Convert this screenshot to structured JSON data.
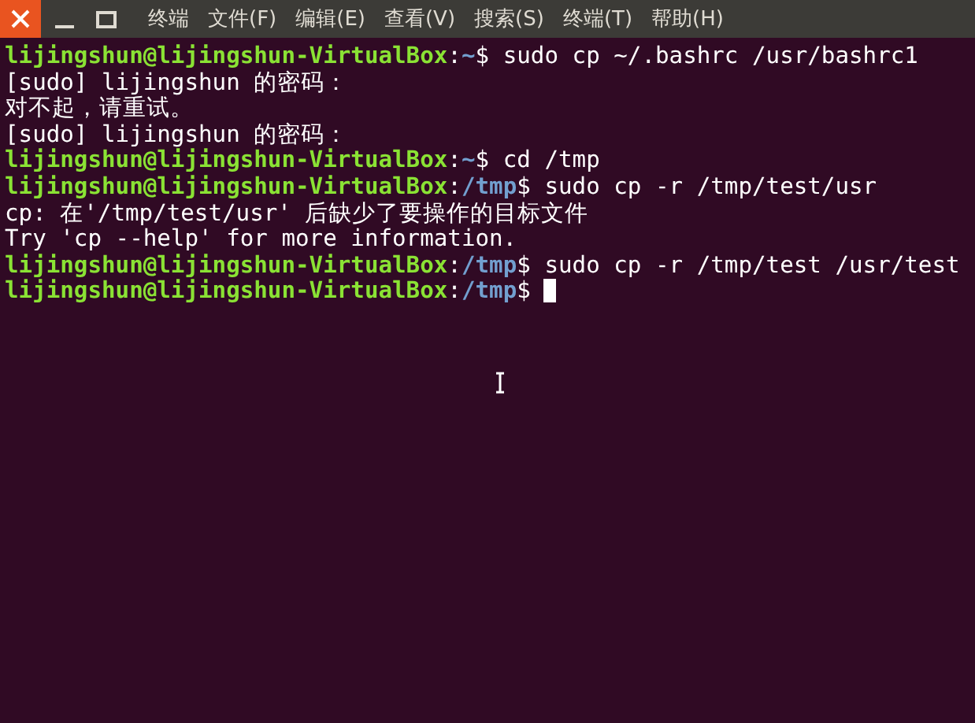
{
  "window": {
    "menu": [
      "终端",
      "文件(F)",
      "编辑(E)",
      "查看(V)",
      "搜索(S)",
      "终端(T)",
      "帮助(H)"
    ]
  },
  "lines": [
    {
      "kind": "prompt",
      "user": "lijingshun@lijingshun-VirtualBox",
      "colon": ":",
      "path": "~",
      "symbol": "$",
      "command": "sudo cp ~/.bashrc /usr/bashrc1",
      "cursor": false
    },
    {
      "kind": "output",
      "text": "[sudo] lijingshun 的密码："
    },
    {
      "kind": "output",
      "text": "对不起，请重试。"
    },
    {
      "kind": "output",
      "text": "[sudo] lijingshun 的密码："
    },
    {
      "kind": "prompt",
      "user": "lijingshun@lijingshun-VirtualBox",
      "colon": ":",
      "path": "~",
      "symbol": "$",
      "command": "cd /tmp",
      "cursor": false
    },
    {
      "kind": "prompt",
      "user": "lijingshun@lijingshun-VirtualBox",
      "colon": ":",
      "path": "/tmp",
      "symbol": "$",
      "command": "sudo cp -r /tmp/test/usr",
      "cursor": false
    },
    {
      "kind": "output",
      "text": "cp: 在'/tmp/test/usr' 后缺少了要操作的目标文件"
    },
    {
      "kind": "output",
      "text": "Try 'cp --help' for more information."
    },
    {
      "kind": "prompt",
      "user": "lijingshun@lijingshun-VirtualBox",
      "colon": ":",
      "path": "/tmp",
      "symbol": "$",
      "command": "sudo cp -r /tmp/test /usr/test",
      "cursor": false
    },
    {
      "kind": "prompt",
      "user": "lijingshun@lijingshun-VirtualBox",
      "colon": ":",
      "path": "/tmp",
      "symbol": "$",
      "cursor": true
    }
  ]
}
